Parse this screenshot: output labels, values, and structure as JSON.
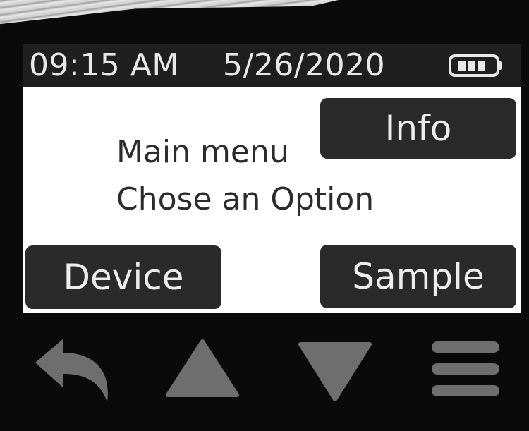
{
  "status_bar": {
    "time": "09:15 AM",
    "date": "5/26/2020",
    "battery_icon": "battery-full-icon"
  },
  "main": {
    "line1": "Main menu",
    "line2": "Chose an Option"
  },
  "buttons": {
    "info": "Info",
    "device": "Device",
    "sample": "Sample"
  },
  "nav": {
    "back_icon": "back-arrow-icon",
    "up_icon": "triangle-up-icon",
    "down_icon": "triangle-down-icon",
    "menu_icon": "hamburger-menu-icon"
  },
  "colors": {
    "screen_bg": "#ffffff",
    "bezel_bg": "#0a0a0a",
    "button_bg": "#2a2a2a",
    "button_text": "#ededed",
    "nav_icon": "#6e6e6e"
  }
}
